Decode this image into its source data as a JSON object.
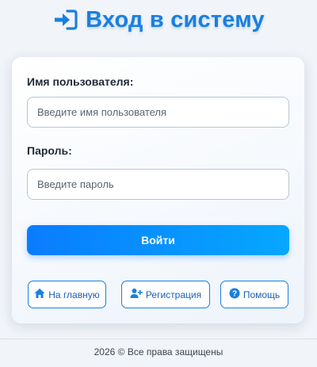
{
  "header": {
    "icon": "sign-in-icon",
    "title": "Вход в систему"
  },
  "form": {
    "username_label": "Имя пользователя:",
    "username_placeholder": "Введите имя пользователя",
    "password_label": "Пароль:",
    "password_placeholder": "Введите пароль",
    "submit_label": "Войти"
  },
  "links": [
    {
      "label": "На главную",
      "icon": "home-icon"
    },
    {
      "label": "Регистрация",
      "icon": "user-plus-icon"
    },
    {
      "label": "Помощь",
      "icon": "question-circle-icon"
    }
  ],
  "footer": {
    "text": "2026 © Все права защищены"
  },
  "colors": {
    "accent": "#1a7fe0",
    "button_start": "#0a7cff",
    "button_end": "#06a7ff",
    "background": "#f1f4f8"
  }
}
